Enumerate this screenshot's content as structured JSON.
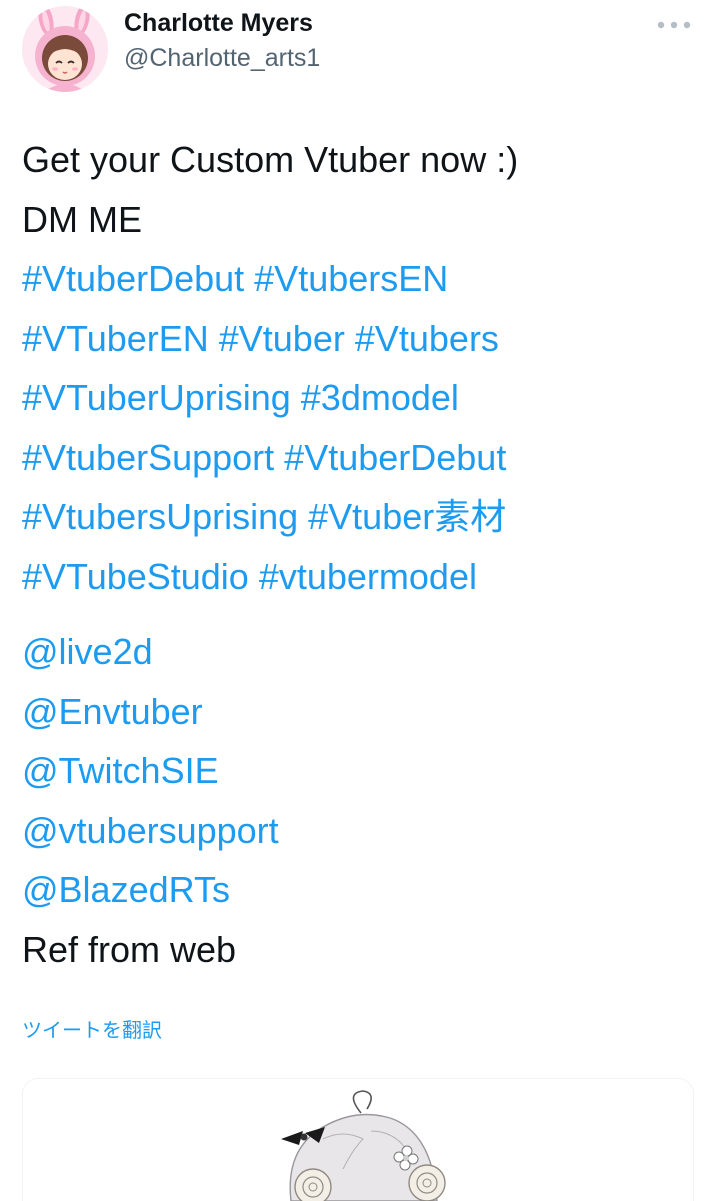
{
  "tweet": {
    "author": {
      "display_name": "Charlotte Myers",
      "username": "@Charlotte_arts1",
      "avatar_icon": "bunny-hood-avatar-icon"
    },
    "more_icon": "more-options-icon",
    "lines_intro": [
      "Get your Custom Vtuber now :)",
      "DM ME"
    ],
    "hashtag_lines": [
      "#VtuberDebut #VtubersEN",
      "#VTuberEN #Vtuber #Vtubers",
      "#VTuberUprising #3dmodel",
      "#VtuberSupport  #VtuberDebut",
      "#VtubersUprising #Vtuber素材",
      "#VTubeStudio #vtubermodel"
    ],
    "mentions": [
      "@live2d",
      "@Envtuber",
      "@TwitchSIE",
      "@vtubersupport",
      "@BlazedRTs"
    ],
    "closing_line": "Ref from web",
    "translate_label": "ツイートを翻訳",
    "media_icon": "anime-character-illustration",
    "link_color": "#1d9bf0"
  }
}
